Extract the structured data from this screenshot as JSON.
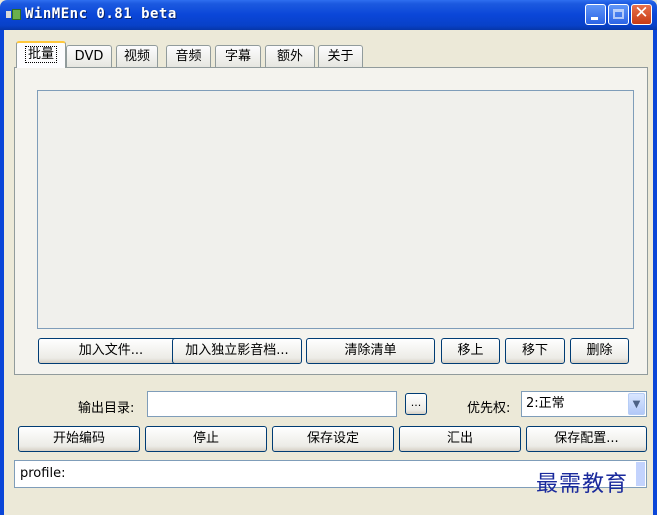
{
  "window": {
    "title": "WinMEnc 0.81 beta",
    "colors": {
      "titlebar": "#0a46d8",
      "face": "#ece9d8",
      "active_tab_highlight": "#ffc83c",
      "close_button": "#c73b15"
    },
    "icons": [
      "app-icon",
      "minimize-icon",
      "maximize-icon",
      "close-icon"
    ]
  },
  "tabs": [
    {
      "label": "批量",
      "active": true
    },
    {
      "label": "DVD"
    },
    {
      "label": "视频"
    },
    {
      "label": "音频"
    },
    {
      "label": "字幕"
    },
    {
      "label": "额外"
    },
    {
      "label": "关于"
    }
  ],
  "batch_buttons": {
    "add_file": "加入文件...",
    "add_av": "加入独立影音档...",
    "clear_list": "清除清单",
    "move_up": "移上",
    "move_down": "移下",
    "delete": "删除"
  },
  "output": {
    "dir_label": "输出目录:",
    "dir_value": "",
    "browse_label": "...",
    "priority_label": "优先权:",
    "priority_value": "2:正常"
  },
  "actions": {
    "start": "开始编码",
    "stop": "停止",
    "save_settings": "保存设定",
    "export": "汇出",
    "save_config": "保存配置..."
  },
  "profile": {
    "text": "profile:"
  },
  "watermark": "最需教育"
}
